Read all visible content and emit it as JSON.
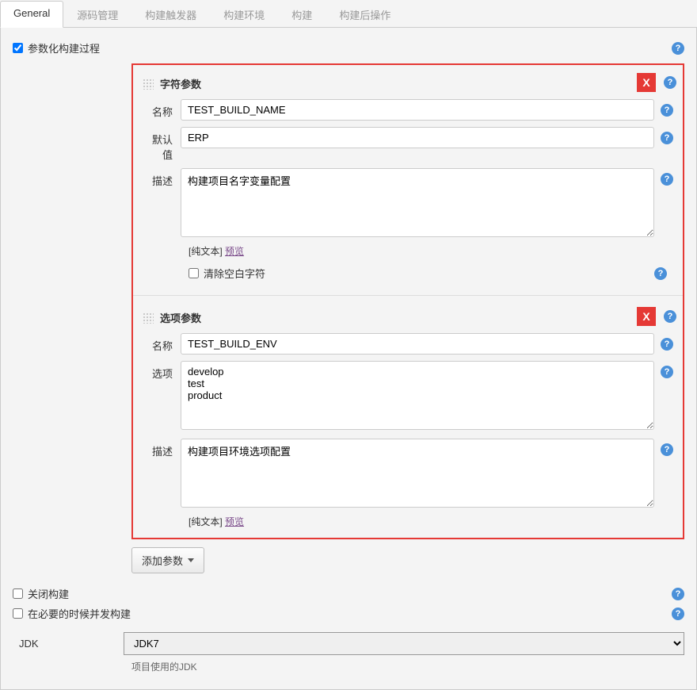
{
  "tabs": {
    "general": "General",
    "scm": "源码管理",
    "triggers": "构建触发器",
    "env": "构建环境",
    "build": "构建",
    "post": "构建后操作"
  },
  "paramBuild": {
    "label": "参数化构建过程"
  },
  "stringParam": {
    "title": "字符参数",
    "nameLabel": "名称",
    "nameValue": "TEST_BUILD_NAME",
    "defaultLabel": "默认值",
    "defaultValue": "ERP",
    "descLabel": "描述",
    "descValue": "构建项目名字变量配置",
    "plainText": "[纯文本] ",
    "previewLink": "预览",
    "trimLabel": "清除空白字符"
  },
  "choiceParam": {
    "title": "选项参数",
    "nameLabel": "名称",
    "nameValue": "TEST_BUILD_ENV",
    "choicesLabel": "选项",
    "choicesValue": "develop\ntest\nproduct",
    "descLabel": "描述",
    "descValue": "构建项目环境选项配置",
    "plainText": "[纯文本] ",
    "previewLink": "预览"
  },
  "addParam": {
    "label": "添加参数"
  },
  "disableBuild": {
    "label": "关闭构建"
  },
  "concurrentBuild": {
    "label": "在必要的时候并发构建"
  },
  "jdk": {
    "label": "JDK",
    "value": "JDK7",
    "caption": "项目使用的JDK"
  },
  "closeX": "X"
}
